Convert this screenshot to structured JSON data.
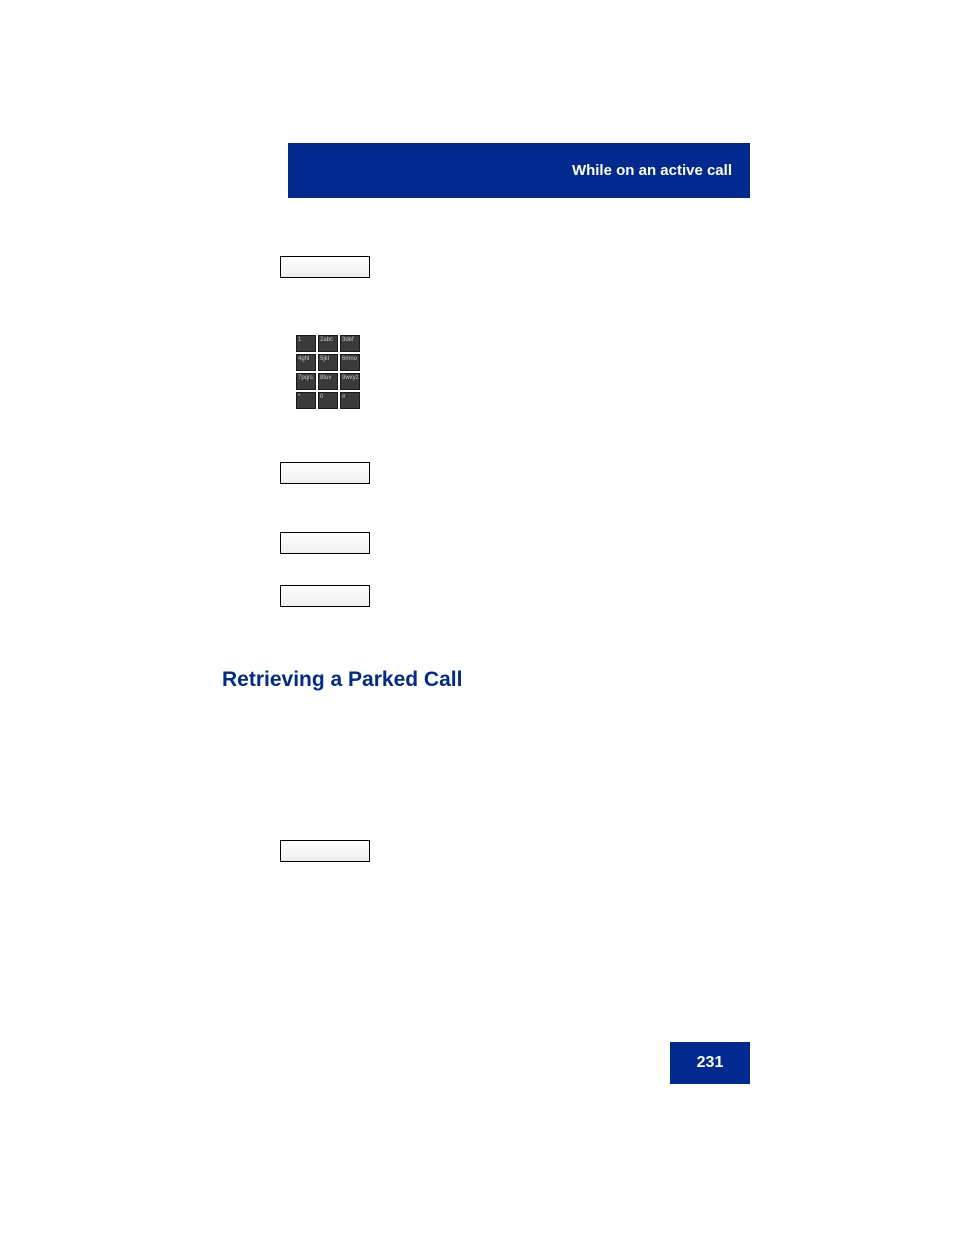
{
  "header": {
    "title": "While on an active call"
  },
  "keypad": {
    "keys": [
      "1",
      "2abc",
      "3def",
      "4ghi",
      "5jkl",
      "6mno",
      "7pqrs",
      "8tuv",
      "9wxyz",
      "*",
      "0",
      "#"
    ]
  },
  "section": {
    "heading": "Retrieving a Parked Call"
  },
  "footer": {
    "page_number": "231"
  }
}
